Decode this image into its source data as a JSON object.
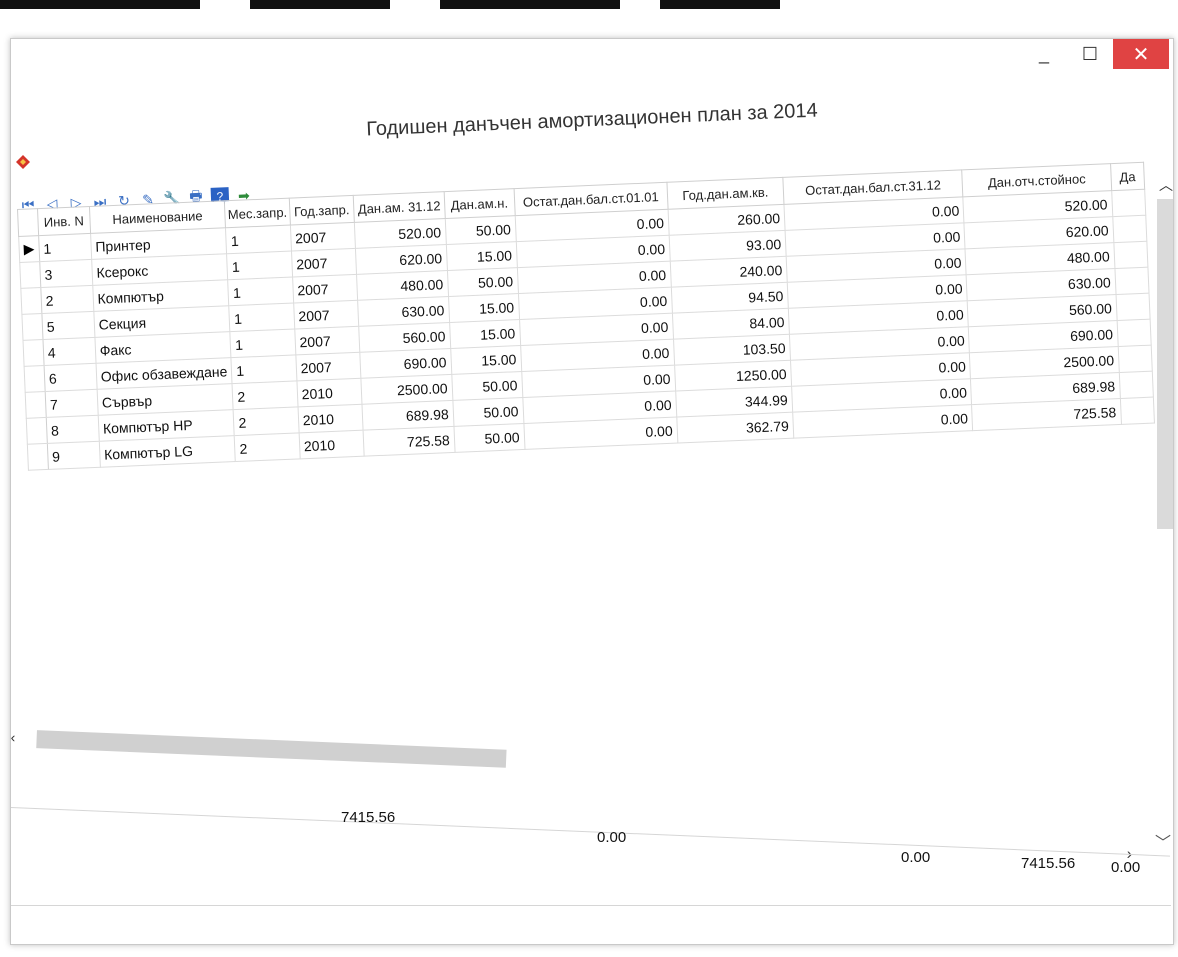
{
  "window": {
    "title": "Годишен данъчен амортизационен план за 2014",
    "controls": {
      "minimize": "_",
      "maximize": "☐",
      "close": "✕"
    }
  },
  "toolbar": {
    "buttons": [
      "first",
      "prev",
      "next",
      "last",
      "refresh",
      "edit",
      "settings",
      "print",
      "help",
      "export"
    ]
  },
  "grid": {
    "columns": [
      "Инв. N",
      "Наименование",
      "Мес.запр.",
      "Год.запр.",
      "Дан.ам. 31.12",
      "Дан.ам.н.",
      "Остат.дан.бал.ст.01.01",
      "Год.дан.ам.кв.",
      "Остат.дан.бал.ст.31.12",
      "Дан.отч.стойнос",
      "Да"
    ],
    "rows": [
      [
        "1",
        "Принтер",
        "1",
        "2007",
        "520.00",
        "50.00",
        "0.00",
        "260.00",
        "0.00",
        "520.00"
      ],
      [
        "3",
        "Ксерокс",
        "1",
        "2007",
        "620.00",
        "15.00",
        "0.00",
        "93.00",
        "0.00",
        "620.00"
      ],
      [
        "2",
        "Компютър",
        "1",
        "2007",
        "480.00",
        "50.00",
        "0.00",
        "240.00",
        "0.00",
        "480.00"
      ],
      [
        "5",
        "Секция",
        "1",
        "2007",
        "630.00",
        "15.00",
        "0.00",
        "94.50",
        "0.00",
        "630.00"
      ],
      [
        "4",
        "Факс",
        "1",
        "2007",
        "560.00",
        "15.00",
        "0.00",
        "84.00",
        "0.00",
        "560.00"
      ],
      [
        "6",
        "Офис обзавеждане",
        "1",
        "2007",
        "690.00",
        "15.00",
        "0.00",
        "103.50",
        "0.00",
        "690.00"
      ],
      [
        "7",
        "Сървър",
        "2",
        "2010",
        "2500.00",
        "50.00",
        "0.00",
        "1250.00",
        "0.00",
        "2500.00"
      ],
      [
        "8",
        "Компютър HP",
        "2",
        "2010",
        "689.98",
        "50.00",
        "0.00",
        "344.99",
        "0.00",
        "689.98"
      ],
      [
        "9",
        "Компютър LG",
        "2",
        "2010",
        "725.58",
        "50.00",
        "0.00",
        "362.79",
        "0.00",
        "725.58"
      ]
    ]
  },
  "totals": {
    "dan_am_3112": "7415.56",
    "ostat_0101": "0.00",
    "ostat_3112": "0.00",
    "dan_otch_stoinost": "7415.56",
    "last": "0.00"
  },
  "colors": {
    "close_button": "#e04343",
    "scroll_thumb": "#d0d0d0",
    "app_icon": "#d4342a"
  }
}
